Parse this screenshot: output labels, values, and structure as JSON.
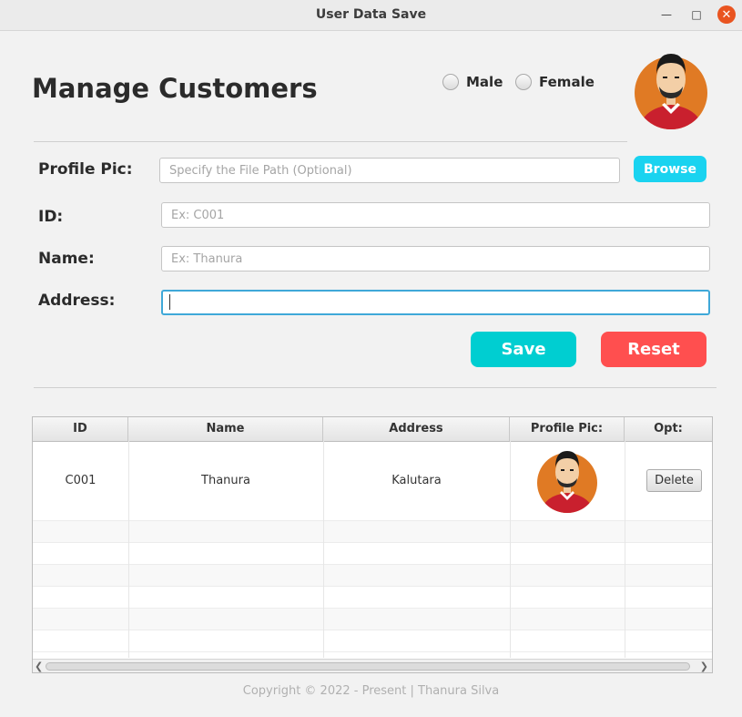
{
  "window": {
    "title": "User Data Save"
  },
  "heading": "Manage Customers",
  "gender": {
    "male_label": "Male",
    "female_label": "Female"
  },
  "form": {
    "profile_pic_label": "Profile Pic:",
    "profile_pic_placeholder": "Specify the File Path (Optional)",
    "browse_label": "Browse",
    "id_label": "ID:",
    "id_placeholder": "Ex: C001",
    "name_label": "Name:",
    "name_placeholder": "Ex: Thanura",
    "address_label": "Address:",
    "address_value": "",
    "save_label": "Save",
    "reset_label": "Reset"
  },
  "table": {
    "headers": [
      "ID",
      "Name",
      "Address",
      "Profile Pic:",
      "Opt:"
    ],
    "rows": [
      {
        "id": "C001",
        "name": "Thanura",
        "address": "Kalutara",
        "delete_label": "Delete"
      }
    ]
  },
  "footer": "Copyright © 2022 - Present | Thanura Silva",
  "colors": {
    "browse": "#1ad3f0",
    "save": "#00ced1",
    "reset": "#ff4f4f",
    "close": "#e95420"
  }
}
